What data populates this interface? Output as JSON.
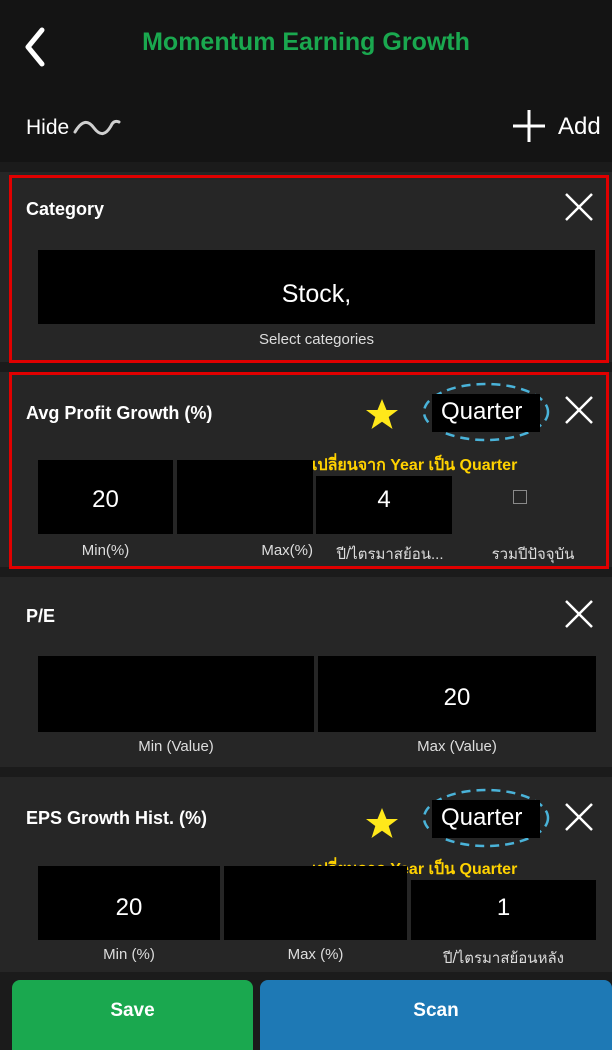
{
  "header": {
    "title": "Momentum Earning Growth",
    "hide_label": "Hide",
    "add_label": "Add"
  },
  "category": {
    "label": "Category",
    "value": "Stock,",
    "caption": "Select categories"
  },
  "avg_profit": {
    "label": "Avg Profit Growth (%)",
    "period": "Quarter",
    "note": "เปลี่ยนจาก Year เป็น Quarter",
    "min_value": "20",
    "max_value": "",
    "years_value": "4",
    "min_caption": "Min(%)",
    "max_caption": "Max(%)",
    "years_caption": "ปี/ไตรมาสย้อน...",
    "include_caption": "รวมปีปัจจุบัน"
  },
  "pe": {
    "label": "P/E",
    "min_value": "",
    "max_value": "20",
    "min_caption": "Min (Value)",
    "max_caption": "Max (Value)"
  },
  "eps_growth": {
    "label": "EPS Growth Hist. (%)",
    "period": "Quarter",
    "note": "เปลี่ยนจาก Year เป็น Quarter",
    "min_value": "20",
    "max_value": "",
    "years_value": "1",
    "min_caption": "Min (%)",
    "max_caption": "Max (%)",
    "years_caption": "ปี/ไตรมาสย้อนหลัง"
  },
  "footer": {
    "save_label": "Save",
    "scan_label": "Scan"
  },
  "colors": {
    "title_green": "#1aa84f",
    "save_green": "#1aa84f",
    "scan_blue": "#1e79b5",
    "highlight_red": "#e00000",
    "annotation_yellow": "#ffd200",
    "dashed_blue": "#4ab3d9"
  }
}
